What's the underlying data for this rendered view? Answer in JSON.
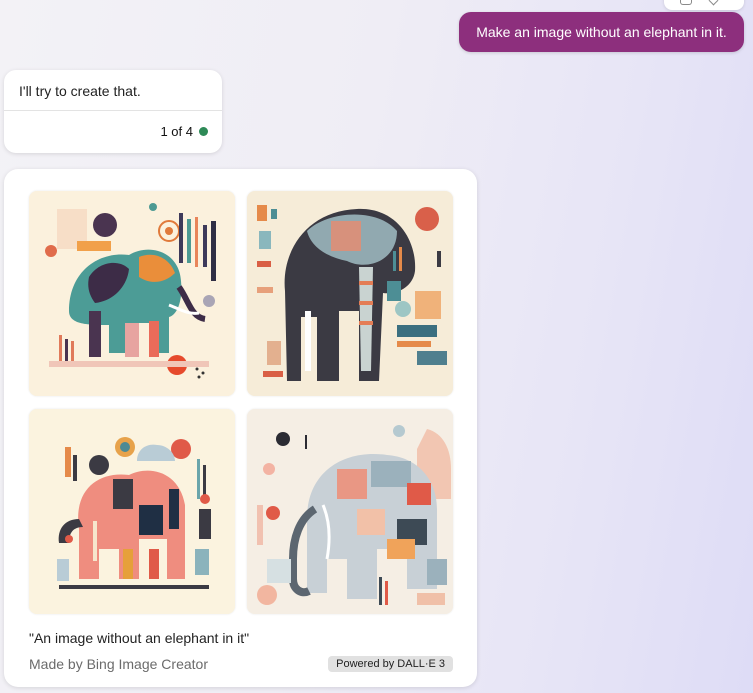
{
  "conversation": {
    "user_message": "Make an image without an elephant in it.",
    "bot_message": "I'll try to create that.",
    "counter": "1 of 4",
    "status_color": "#2e8a57"
  },
  "image_card": {
    "images": [
      {
        "alt": "Abstract elephant artwork 1"
      },
      {
        "alt": "Abstract elephant artwork 2"
      },
      {
        "alt": "Abstract elephant artwork 3"
      },
      {
        "alt": "Abstract elephant artwork 4"
      }
    ],
    "caption": "\"An image without an elephant in it\"",
    "made_by": "Made by Bing Image Creator",
    "powered_by": "Powered by DALL·E 3"
  },
  "colors": {
    "user_bubble": "#8d2f7d",
    "card_bg": "#ffffff",
    "thumb_bg": "#fbf3e0"
  }
}
